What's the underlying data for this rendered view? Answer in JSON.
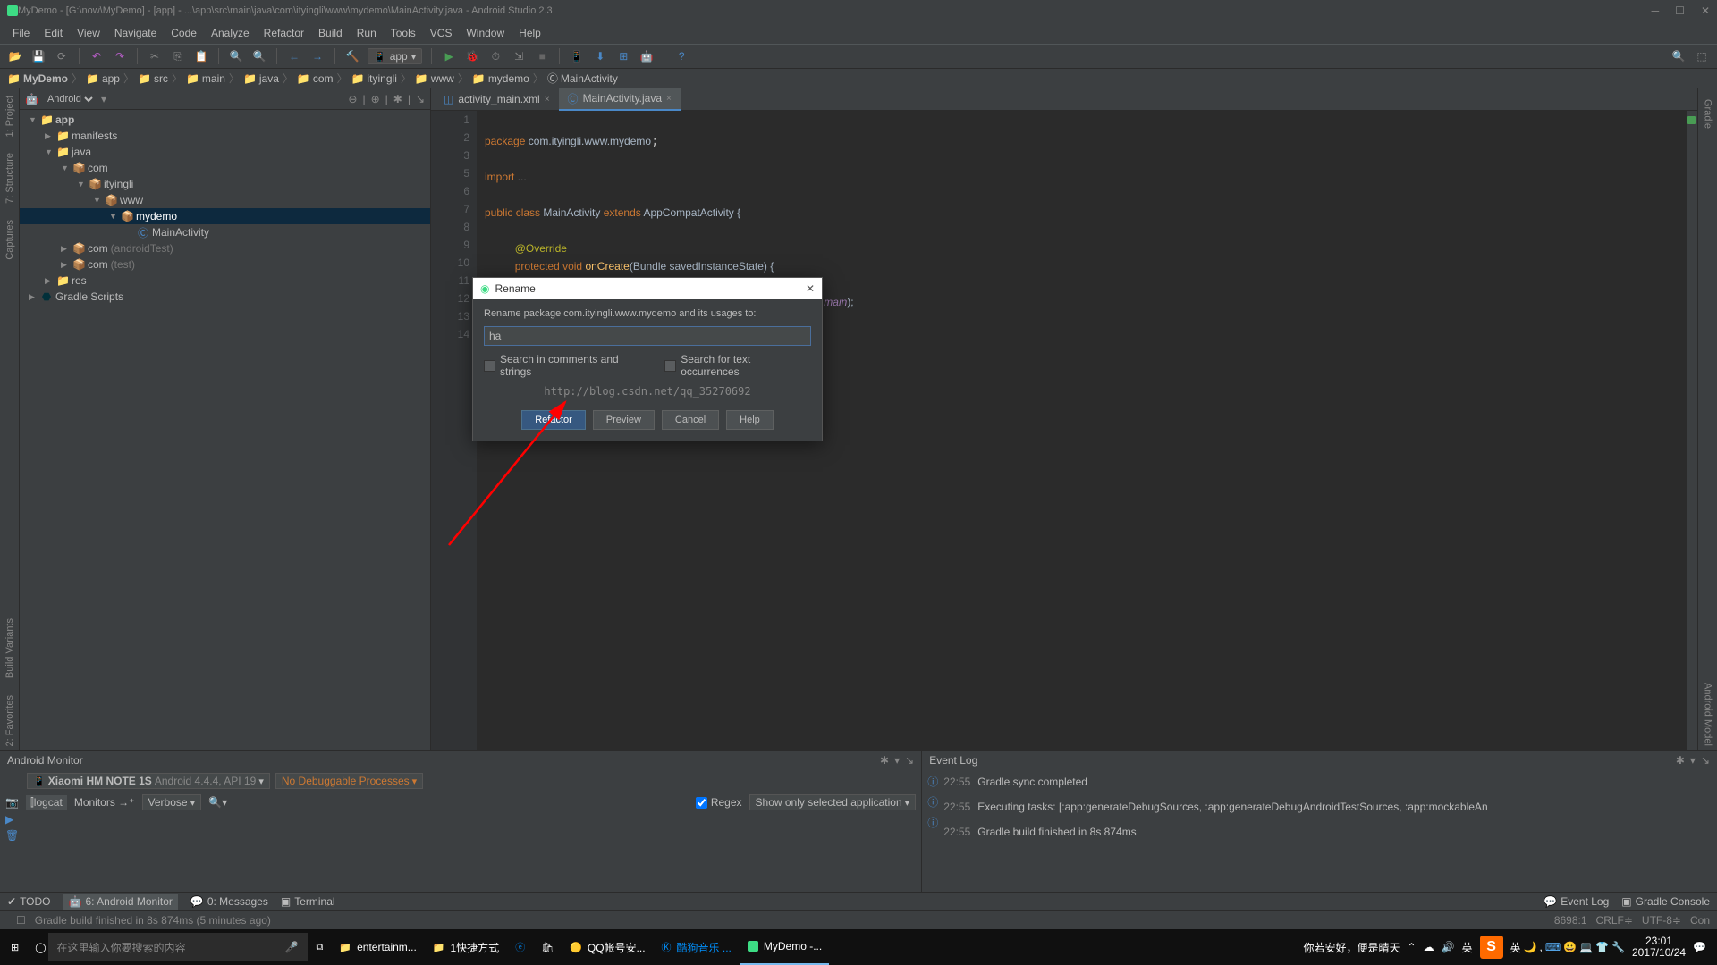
{
  "titlebar": {
    "title": "MyDemo - [G:\\now\\MyDemo] - [app] - ...\\app\\src\\main\\java\\com\\ityingli\\www\\mydemo\\MainActivity.java - Android Studio 2.3"
  },
  "menu": [
    "File",
    "Edit",
    "View",
    "Navigate",
    "Code",
    "Analyze",
    "Refactor",
    "Build",
    "Run",
    "Tools",
    "VCS",
    "Window",
    "Help"
  ],
  "run_config": "app",
  "breadcrumb": [
    "MyDemo",
    "app",
    "src",
    "main",
    "java",
    "com",
    "ityingli",
    "www",
    "mydemo",
    "MainActivity"
  ],
  "project": {
    "view": "Android",
    "tree": {
      "app": "app",
      "manifests": "manifests",
      "java": "java",
      "com": "com",
      "ityingli": "ityingli",
      "www": "www",
      "mydemo": "mydemo",
      "mainactivity": "MainActivity",
      "com_at": "com",
      "at": "(androidTest)",
      "com_test": "com",
      "test": "(test)",
      "res": "res",
      "gradle": "Gradle Scripts"
    }
  },
  "tabs": {
    "t1": "activity_main.xml",
    "t2": "MainActivity.java"
  },
  "code": {
    "l1a": "package ",
    "l1b": "com.ityingli.www.mydemo",
    "l3a": "import ",
    "l3b": "...",
    "l6a": "public class ",
    "l6b": "MainActivity ",
    "l6c": "extends ",
    "l6d": "AppCompatActivity {",
    "l8": "@Override",
    "l9a": "protected ",
    "l9b": "void ",
    "l9c": "onCreate",
    "l9d": "(Bundle savedInstanceState) {",
    "l10": ");",
    "l11a": "main",
    "l11b": ");",
    "lines": [
      "1",
      "2",
      "3",
      "5",
      "6",
      "7",
      "8",
      "9",
      "10",
      "11",
      "12",
      "13",
      "14"
    ]
  },
  "dialog": {
    "title": "Rename",
    "label": "Rename package com.ityingli.www.mydemo and its usages to:",
    "value": "ha",
    "chk1": "Search in comments and strings",
    "chk2": "Search for text occurrences",
    "watermark": "http://blog.csdn.net/qq_35270692",
    "refactor": "Refactor",
    "preview": "Preview",
    "cancel": "Cancel",
    "help": "Help"
  },
  "monitor": {
    "title": "Android Monitor",
    "device": "Xiaomi HM NOTE 1S",
    "api": "Android 4.4.4, API 19",
    "noproc": "No Debuggable Processes",
    "logcat": "logcat",
    "monitors": "Monitors",
    "verbose": "Verbose",
    "regex": "Regex",
    "filter": "Show only selected application"
  },
  "eventlog": {
    "title": "Event Log",
    "rows": [
      {
        "time": "22:55",
        "msg": "Gradle sync completed"
      },
      {
        "time": "22:55",
        "msg": "Executing tasks: [:app:generateDebugSources, :app:generateDebugAndroidTestSources, :app:mockableAn"
      },
      {
        "time": "22:55",
        "msg": "Gradle build finished in 8s 874ms"
      }
    ]
  },
  "bottomtabs": {
    "todo": "TODO",
    "monitor": "6: Android Monitor",
    "messages": "0: Messages",
    "terminal": "Terminal",
    "eventlog": "Event Log",
    "gradlec": "Gradle Console"
  },
  "status": {
    "msg": "Gradle build finished in 8s 874ms (5 minutes ago)",
    "pos": "8698:1",
    "eol": "CRLF≑",
    "enc": "UTF-8≑",
    "ctx": "Con"
  },
  "taskbar": {
    "search": "在这里输入你要搜索的内容",
    "items": [
      "entertainm...",
      "1快捷方式",
      "",
      "",
      "QQ帐号安...",
      "酷狗音乐 ...",
      "MyDemo -..."
    ],
    "tray_text": "你若安好，便是晴天",
    "time": "23:01",
    "date": "2017/10/24"
  }
}
